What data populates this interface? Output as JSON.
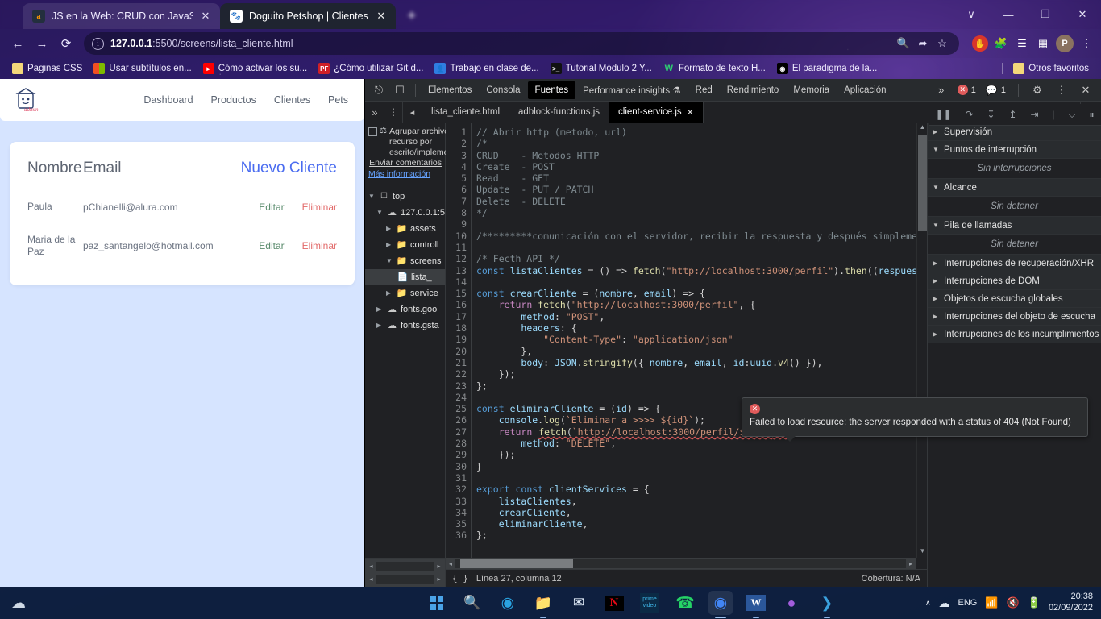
{
  "browser": {
    "tabs": [
      {
        "title": "JS en la Web: CRUD con JavaScri",
        "favicon": "amazon-icon",
        "active": false
      },
      {
        "title": "Doguito Petshop | Clientes",
        "favicon": "dog-icon",
        "active": true
      }
    ],
    "new_tab_label": "+",
    "window_controls": {
      "chevron": "∨",
      "minimize": "—",
      "maximize": "❐",
      "close": "✕"
    },
    "nav": {
      "back": "←",
      "forward": "→",
      "reload": "⟳"
    },
    "omnibox": {
      "url_host": "127.0.0.1",
      "url_rest": ":5500/screens/lista_cliente.html",
      "info_icon": "i"
    },
    "omni_actions": [
      "zoom-search-icon",
      "share-icon",
      "bookmark-star-icon"
    ],
    "extensions": [
      "adblock-icon",
      "puzzle-extensions-icon",
      "reading-list-icon",
      "side-panel-icon"
    ],
    "profile_initial": "P",
    "menu_icon": "⋮",
    "bookmarks": [
      {
        "label": "Paginas CSS",
        "icon": "folder-icon"
      },
      {
        "label": "Usar subtítulos en...",
        "icon": "microsoft-icon"
      },
      {
        "label": "Cómo activar los su...",
        "icon": "youtube-icon"
      },
      {
        "label": "¿Cómo utilizar Git d...",
        "icon": "pf-icon"
      },
      {
        "label": "Trabajo en clase de...",
        "icon": "contact-icon"
      },
      {
        "label": "Tutorial Módulo 2 Y...",
        "icon": "terminal-icon"
      },
      {
        "label": "Formato de texto H...",
        "icon": "w3-icon"
      },
      {
        "label": "El paradigma de la...",
        "icon": "media-icon"
      }
    ],
    "other_bookmarks": {
      "label": "Otros favoritos",
      "icon": "folder-icon"
    }
  },
  "webpage": {
    "logo_alt": "doguito-admin-logo",
    "nav": [
      "Dashboard",
      "Productos",
      "Clientes",
      "Pets"
    ],
    "table": {
      "col_nombre": "Nombre",
      "col_email": "Email",
      "new_client": "Nuevo Cliente",
      "rows": [
        {
          "nombre": "Paula",
          "email": "pChianelli@alura.com",
          "edit": "Editar",
          "delete": "Eliminar"
        },
        {
          "nombre": "Maria de la Paz",
          "email": "paz_santangelo@hotmail.com",
          "edit": "Editar",
          "delete": "Eliminar"
        }
      ]
    }
  },
  "devtools": {
    "panel_tabs": [
      "Elementos",
      "Consola",
      "Fuentes",
      "Performance insights",
      "Red",
      "Rendimiento",
      "Memoria",
      "Aplicación"
    ],
    "active_panel_tab": "Fuentes",
    "performance_flask": "⚗",
    "overflow": "»",
    "error_count": "1",
    "message_count": "1",
    "settings_icon": "⚙",
    "more_icon": "⋮",
    "close_icon": "✕",
    "debug_controls": [
      "pause-icon",
      "step-over-icon",
      "step-into-icon",
      "step-out-icon",
      "step-icon",
      "deactivate-breakpoints-icon",
      "pause-on-exceptions-icon"
    ],
    "file_tabs": [
      {
        "label": "lista_cliente.html",
        "active": false,
        "closable": false
      },
      {
        "label": "adblock-functions.js",
        "active": false,
        "closable": false
      },
      {
        "label": "client-service.js",
        "active": true,
        "closable": true
      }
    ],
    "navigator": {
      "checkbox_label": "Agrupar archivos de recurso por escrito/implementado",
      "send_feedback": "Enviar comentarios",
      "more_info": "Más información",
      "tree": [
        {
          "indent": 0,
          "label": "top",
          "icon": "frame-icon",
          "state": "open"
        },
        {
          "indent": 1,
          "label": "127.0.0.1:5",
          "icon": "cloud-icon",
          "state": "open"
        },
        {
          "indent": 2,
          "label": "assets",
          "icon": "folder-icon",
          "state": "closed"
        },
        {
          "indent": 2,
          "label": "controll",
          "icon": "folder-icon",
          "state": "closed"
        },
        {
          "indent": 2,
          "label": "screens",
          "icon": "folder-icon",
          "state": "open"
        },
        {
          "indent": 3,
          "label": "lista_",
          "icon": "file-icon",
          "state": "none",
          "selected": true
        },
        {
          "indent": 2,
          "label": "service",
          "icon": "folder-icon",
          "state": "closed"
        },
        {
          "indent": 1,
          "label": "fonts.goo",
          "icon": "cloud-icon",
          "state": "closed"
        },
        {
          "indent": 1,
          "label": "fonts.gsta",
          "icon": "cloud-icon",
          "state": "closed"
        }
      ]
    },
    "code_lines": [
      {
        "n": 1,
        "html": "<span class=\"c-com\">// Abrir http (metodo, url)</span>"
      },
      {
        "n": 2,
        "html": "<span class=\"c-com\">/*</span>"
      },
      {
        "n": 3,
        "html": "<span class=\"c-com\">CRUD    - Metodos HTTP</span>"
      },
      {
        "n": 4,
        "html": "<span class=\"c-com\">Create  - POST</span>"
      },
      {
        "n": 5,
        "html": "<span class=\"c-com\">Read    - GET</span>"
      },
      {
        "n": 6,
        "html": "<span class=\"c-com\">Update  - PUT / PATCH</span>"
      },
      {
        "n": 7,
        "html": "<span class=\"c-com\">Delete  - DELETE</span>"
      },
      {
        "n": 8,
        "html": "<span class=\"c-com\">*/</span>"
      },
      {
        "n": 9,
        "html": ""
      },
      {
        "n": 10,
        "html": "<span class=\"c-com\">/*********comunicación con el servidor, recibir la respuesta y después simplement</span>"
      },
      {
        "n": 11,
        "html": ""
      },
      {
        "n": 12,
        "html": "<span class=\"c-com\">/* Fecth API */</span>"
      },
      {
        "n": 13,
        "html": "<span class=\"c-kw2\">const</span> <span class=\"c-var\">listaClientes</span> = () =&gt; <span class=\"c-fn\">fetch</span>(<span class=\"c-str\">\"http://localhost:3000/perfil\"</span>).<span class=\"c-fn\">then</span>((<span class=\"c-var\">respuesta</span>"
      },
      {
        "n": 14,
        "html": ""
      },
      {
        "n": 15,
        "html": "<span class=\"c-kw2\">const</span> <span class=\"c-var\">crearCliente</span> = (<span class=\"c-var\">nombre</span>, <span class=\"c-var\">email</span>) =&gt; {"
      },
      {
        "n": 16,
        "html": "    <span class=\"c-kw\">return</span> <span class=\"c-fn\">fetch</span>(<span class=\"c-str\">\"http://localhost:3000/perfil\"</span>, {"
      },
      {
        "n": 17,
        "html": "        <span class=\"c-prop\">method</span>: <span class=\"c-str\">\"POST\"</span>,"
      },
      {
        "n": 18,
        "html": "        <span class=\"c-prop\">headers</span>: {"
      },
      {
        "n": 19,
        "html": "            <span class=\"c-str\">\"Content-Type\"</span>: <span class=\"c-str\">\"application/json\"</span>"
      },
      {
        "n": 20,
        "html": "        },"
      },
      {
        "n": 21,
        "html": "        <span class=\"c-prop\">body</span>: <span class=\"c-var\">JSON</span>.<span class=\"c-fn\">stringify</span>({ <span class=\"c-var\">nombre</span>, <span class=\"c-var\">email</span>, <span class=\"c-prop\">id</span>:<span class=\"c-var\">uuid</span>.<span class=\"c-fn\">v4</span>() }),"
      },
      {
        "n": 22,
        "html": "    });"
      },
      {
        "n": 23,
        "html": "};"
      },
      {
        "n": 24,
        "html": ""
      },
      {
        "n": 25,
        "html": "<span class=\"c-kw2\">const</span> <span class=\"c-var\">eliminarCliente</span> = (<span class=\"c-var\">id</span>) =&gt; {"
      },
      {
        "n": 26,
        "html": "    <span class=\"c-var\">console</span>.<span class=\"c-fn\">log</span>(<span class=\"c-str\">`Eliminar a &gt;&gt;&gt;&gt; ${id}`</span>);"
      },
      {
        "n": 27,
        "html": "    <span class=\"c-kw\">return</span> <span class=\"caret\"></span><span class=\"squiggle\"><span class=\"c-fn\">fetch</span>(<span class=\"c-str\">`http://localhost:3000/perfil/${id}`</span>, {</span><span class=\"errdot\">✕</span>"
      },
      {
        "n": 28,
        "html": "        <span class=\"c-prop\">method</span>: <span class=\"c-str\">\"DELETE\"</span>,"
      },
      {
        "n": 29,
        "html": "    });"
      },
      {
        "n": 30,
        "html": "}"
      },
      {
        "n": 31,
        "html": ""
      },
      {
        "n": 32,
        "html": "<span class=\"c-kw2\">export</span> <span class=\"c-kw2\">const</span> <span class=\"c-var\">clientServices</span> = {"
      },
      {
        "n": 33,
        "html": "    <span class=\"c-var\">listaClientes</span>,"
      },
      {
        "n": 34,
        "html": "    <span class=\"c-var\">crearCliente</span>,"
      },
      {
        "n": 35,
        "html": "    <span class=\"c-var\">eliminarCliente</span>,"
      },
      {
        "n": 36,
        "html": "};"
      }
    ],
    "error_tooltip": "Failed to load resource: the server responded with a status of 404 (Not Found)",
    "status_bar": {
      "braces": "{ }",
      "position": "Línea 27, columna 12",
      "coverage": "Cobertura: N/A"
    },
    "debugger_sections": [
      {
        "label": "Supervisión",
        "state": "closed",
        "empty": null
      },
      {
        "label": "Puntos de interrupción",
        "state": "open",
        "empty": "Sin interrupciones"
      },
      {
        "label": "Alcance",
        "state": "open",
        "empty": "Sin detener"
      },
      {
        "label": "Pila de llamadas",
        "state": "open",
        "empty": "Sin detener"
      },
      {
        "label": "Interrupciones de recuperación/XHR",
        "state": "closed",
        "empty": null
      },
      {
        "label": "Interrupciones de DOM",
        "state": "closed",
        "empty": null
      },
      {
        "label": "Objetos de escucha globales",
        "state": "closed",
        "empty": null
      },
      {
        "label": "Interrupciones del objeto de escucha",
        "state": "closed",
        "empty": null
      },
      {
        "label": "Interrupciones de los incumplimientos",
        "state": "closed",
        "empty": null
      }
    ]
  },
  "taskbar": {
    "start": "start-icon",
    "items": [
      "start-icon",
      "search-icon",
      "edge-icon",
      "file-explorer-icon",
      "mail-icon",
      "netflix-icon",
      "prime-video-icon",
      "whatsapp-icon",
      "chrome-icon",
      "word-icon",
      "github-icon",
      "vscode-icon"
    ],
    "tray": {
      "chevron": "∧",
      "onedrive": "onedrive-icon",
      "language": "ENG",
      "wifi": "wifi-icon",
      "volume": "volume-muted-icon",
      "battery": "battery-icon"
    },
    "clock": {
      "time": "20:38",
      "date": "02/09/2022"
    }
  },
  "colors": {
    "accent_blue": "#4a6cf0",
    "edit_green": "#5b8c6e",
    "delete_red": "#e26a6a",
    "error_red": "#e05b5b",
    "devtools_bg": "#202124",
    "page_bg": "#d6e4ff"
  }
}
